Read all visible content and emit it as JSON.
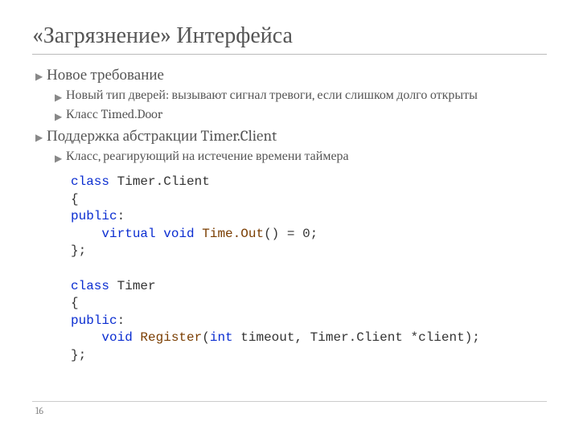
{
  "title": "«Загрязнение» Интерфейса",
  "bullets": {
    "b1": "Новое требование",
    "b1a": "Новый тип дверей: вызывают сигнал тревоги, если слишком долго открыты",
    "b1b": "Класс Timed.Door",
    "b2": "Поддержка абстракции Timer.Client",
    "b2a": "Класс, реагирующий на истечение времени таймера"
  },
  "code": {
    "c1a": "class",
    "c1b": " Timer.Client",
    "c2": "{",
    "c3a": "public",
    "c3b": ":",
    "c4a": "    ",
    "c4b": "virtual",
    "c4c": " ",
    "c4d": "void",
    "c4e": " ",
    "c4f": "Time.Out",
    "c4g": "() = 0;",
    "c5": "};",
    "blank": "",
    "c7a": "class",
    "c7b": " Timer",
    "c8": "{",
    "c9a": "public",
    "c9b": ":",
    "c10a": "    ",
    "c10b": "void",
    "c10c": " ",
    "c10d": "Register",
    "c10e": "(",
    "c10f": "int",
    "c10g": " timeout, Timer.Client *client);",
    "c11": "};"
  },
  "pageNumber": "16",
  "bulletGlyph": "▶"
}
